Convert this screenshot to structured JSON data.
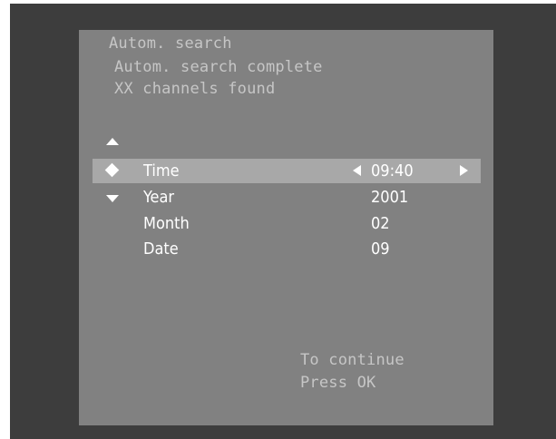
{
  "header": {
    "line1": "Autom. search",
    "line2": "Autom. search complete",
    "line3": "XX channels found"
  },
  "nav": {
    "up_icon": "triangle-up-icon"
  },
  "menu": {
    "items": [
      {
        "label": "Time",
        "value": "09:40",
        "selected": true,
        "left_icon": "diamond-icon"
      },
      {
        "label": "Year",
        "value": "2001",
        "selected": false,
        "left_icon": "triangle-down-icon"
      },
      {
        "label": "Month",
        "value": "02",
        "selected": false
      },
      {
        "label": "Date",
        "value": "09",
        "selected": false
      }
    ]
  },
  "footer": {
    "line1": "To continue",
    "line2": "Press OK"
  },
  "colors": {
    "frame": "#3d3d3d",
    "panel": "#818181",
    "highlight": "#a8a8a8",
    "dim_text": "#c6c6c6",
    "bright_text": "#ffffff"
  }
}
